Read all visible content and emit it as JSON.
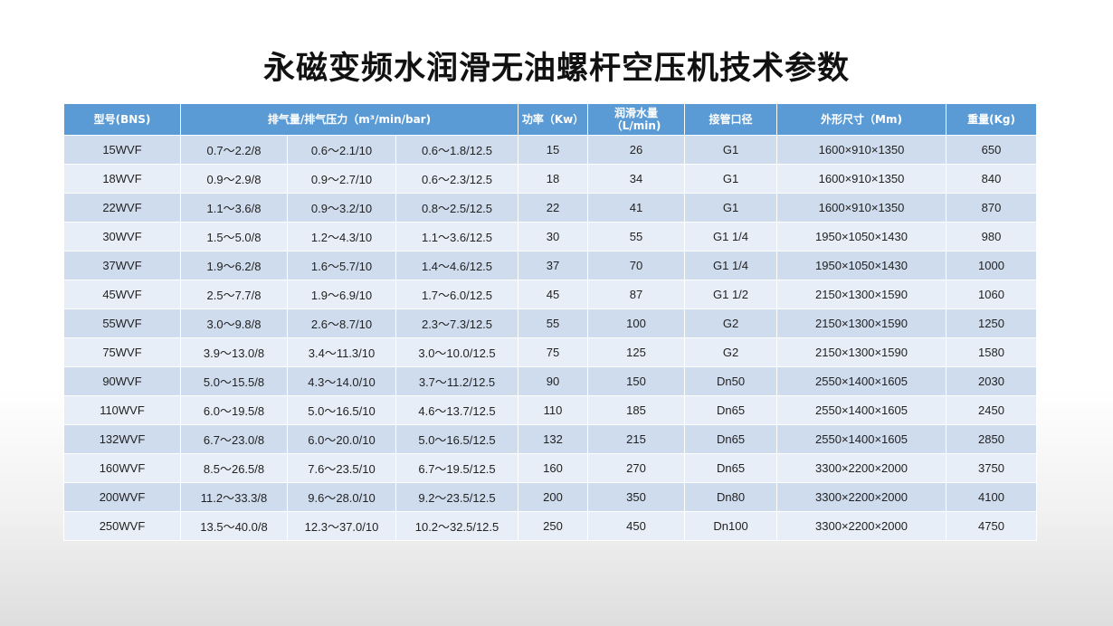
{
  "title": "永磁变频水润滑无油螺杆空压机技术参数",
  "table": {
    "headers": {
      "model": "型号(BNS)",
      "flow_pressure": "排气量/排气压力（m³/min/bar)",
      "power": "功率（Kw）",
      "water": "润滑水量（L/min)",
      "pipe": "接管口径",
      "dimensions": "外形尺寸（Mm)",
      "weight": "重量(Kg)"
    },
    "rows": [
      [
        "15WVF",
        "0.7～2.2/8",
        "0.6～2.1/10",
        "0.6～1.8/12.5",
        "15",
        "26",
        "G1",
        "1600×910×1350",
        "650"
      ],
      [
        "18WVF",
        "0.9～2.9/8",
        "0.9～2.7/10",
        "0.6～2.3/12.5",
        "18",
        "34",
        "G1",
        "1600×910×1350",
        "840"
      ],
      [
        "22WVF",
        "1.1～3.6/8",
        "0.9～3.2/10",
        "0.8～2.5/12.5",
        "22",
        "41",
        "G1",
        "1600×910×1350",
        "870"
      ],
      [
        "30WVF",
        "1.5～5.0/8",
        "1.2～4.3/10",
        "1.1～3.6/12.5",
        "30",
        "55",
        "G1 1/4",
        "1950×1050×1430",
        "980"
      ],
      [
        "37WVF",
        "1.9～6.2/8",
        "1.6～5.7/10",
        "1.4～4.6/12.5",
        "37",
        "70",
        "G1 1/4",
        "1950×1050×1430",
        "1000"
      ],
      [
        "45WVF",
        "2.5～7.7/8",
        "1.9～6.9/10",
        "1.7～6.0/12.5",
        "45",
        "87",
        "G1 1/2",
        "2150×1300×1590",
        "1060"
      ],
      [
        "55WVF",
        "3.0～9.8/8",
        "2.6～8.7/10",
        "2.3～7.3/12.5",
        "55",
        "100",
        "G2",
        "2150×1300×1590",
        "1250"
      ],
      [
        "75WVF",
        "3.9～13.0/8",
        "3.4～11.3/10",
        "3.0～10.0/12.5",
        "75",
        "125",
        "G2",
        "2150×1300×1590",
        "1580"
      ],
      [
        "90WVF",
        "5.0～15.5/8",
        "4.3～14.0/10",
        "3.7～11.2/12.5",
        "90",
        "150",
        "Dn50",
        "2550×1400×1605",
        "2030"
      ],
      [
        "110WVF",
        "6.0～19.5/8",
        "5.0～16.5/10",
        "4.6～13.7/12.5",
        "110",
        "185",
        "Dn65",
        "2550×1400×1605",
        "2450"
      ],
      [
        "132WVF",
        "6.7～23.0/8",
        "6.0～20.0/10",
        "5.0～16.5/12.5",
        "132",
        "215",
        "Dn65",
        "2550×1400×1605",
        "2850"
      ],
      [
        "160WVF",
        "8.5～26.5/8",
        "7.6～23.5/10",
        "6.7～19.5/12.5",
        "160",
        "270",
        "Dn65",
        "3300×2200×2000",
        "3750"
      ],
      [
        "200WVF",
        "11.2～33.3/8",
        "9.6～28.0/10",
        "9.2～23.5/12.5",
        "200",
        "350",
        "Dn80",
        "3300×2200×2000",
        "4100"
      ],
      [
        "250WVF",
        "13.5～40.0/8",
        "12.3～37.0/10",
        "10.2～32.5/12.5",
        "250",
        "450",
        "Dn100",
        "3300×2200×2000",
        "4750"
      ]
    ]
  },
  "colors": {
    "header_bg": "#5b9bd5",
    "row_dark": "#cfdcee",
    "row_light": "#e8eef7"
  }
}
